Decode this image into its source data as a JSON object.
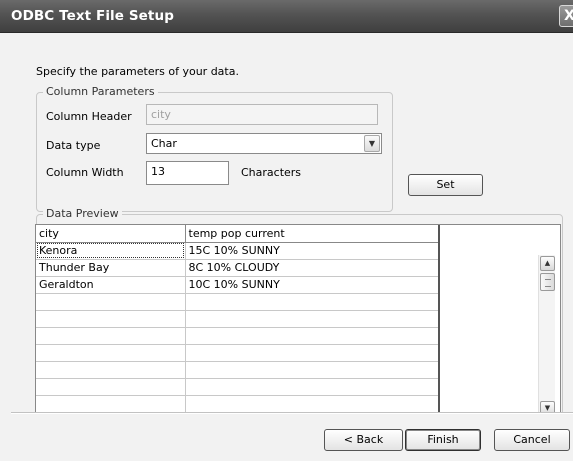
{
  "window": {
    "title": "ODBC Text File Setup",
    "close_glyph": "X"
  },
  "instruction": "Specify the parameters of your data.",
  "column_parameters": {
    "group_title": "Column Parameters",
    "column_header_label": "Column Header",
    "column_header_value": "city",
    "data_type_label": "Data type",
    "data_type_value": "Char",
    "column_width_label": "Column Width",
    "column_width_value": "13",
    "characters_label": "Characters"
  },
  "set_button": "Set",
  "data_preview": {
    "group_title": "Data Preview",
    "header": [
      "city",
      "temp  pop  current"
    ],
    "rows": [
      [
        "Kenora",
        "15C  10%  SUNNY"
      ],
      [
        "Thunder Bay",
        "8C  10%  CLOUDY"
      ],
      [
        "Geraldton",
        "10C  10%  SUNNY"
      ]
    ],
    "scroll_up_icon": "scroll-up-arrow",
    "scroll_down_icon": "scroll-down-arrow"
  },
  "buttons": {
    "back": "< Back",
    "finish": "Finish",
    "cancel": "Cancel"
  }
}
